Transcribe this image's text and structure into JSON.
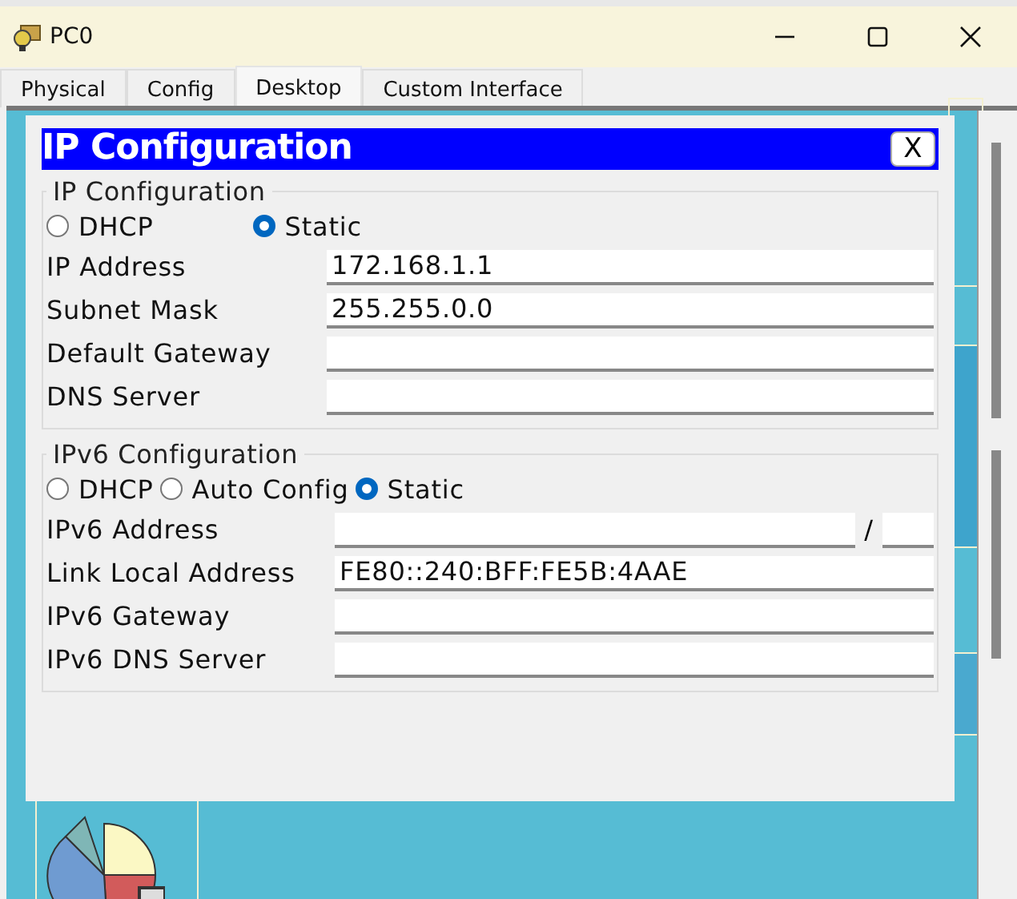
{
  "window": {
    "title": "PC0"
  },
  "tabs": [
    {
      "label": "Physical",
      "selected": false
    },
    {
      "label": "Config",
      "selected": false
    },
    {
      "label": "Desktop",
      "selected": true
    },
    {
      "label": "Custom Interface",
      "selected": false
    }
  ],
  "dialog": {
    "title": "IP Configuration",
    "close_label": "X",
    "sections": [
      {
        "legend": "IP Configuration",
        "modes": [
          {
            "label": "DHCP",
            "selected": false
          },
          {
            "label": "Static",
            "selected": true
          }
        ],
        "fields": [
          {
            "kind": "plain",
            "label": "IP Address",
            "value": "172.168.1.1"
          },
          {
            "kind": "plain",
            "label": "Subnet Mask",
            "value": "255.255.0.0"
          },
          {
            "kind": "plain",
            "label": "Default Gateway"
          },
          {
            "kind": "plain",
            "label": "DNS Server"
          }
        ]
      },
      {
        "legend": "IPv6 Configuration",
        "modes": [
          {
            "label": "DHCP",
            "selected": false
          },
          {
            "label": "Auto Config",
            "selected": false
          },
          {
            "label": "Static",
            "selected": true
          }
        ],
        "fields": [
          {
            "kind": "prefix",
            "label": "IPv6 Address",
            "separator": "/"
          },
          {
            "kind": "plain",
            "label": "Link Local Address",
            "value": "FE80::240:BFF:FE5B:4AAE"
          },
          {
            "kind": "plain",
            "label": "IPv6 Gateway"
          },
          {
            "kind": "plain",
            "label": "IPv6 DNS Server"
          }
        ]
      }
    ]
  }
}
